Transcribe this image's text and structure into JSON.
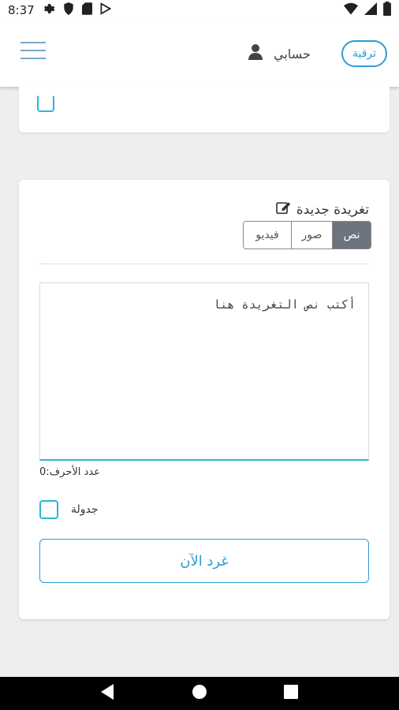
{
  "status_bar": {
    "time": "8:37",
    "icons_left": [
      "settings-icon",
      "shield-icon",
      "sd-card-icon",
      "play-store-icon"
    ],
    "icons_right": [
      "wifi-icon",
      "signal-icon",
      "battery-icon"
    ]
  },
  "header": {
    "menu_icon": "hamburger-menu-icon",
    "account_label": "حسابي",
    "account_icon": "user-icon",
    "upgrade_label": "ترقية",
    "accent_color": "#2f9bd6"
  },
  "compose": {
    "title": "تغريدة جديدة",
    "title_icon": "edit-icon",
    "tabs": [
      {
        "label": "فيديو",
        "active": false
      },
      {
        "label": "صور",
        "active": false
      },
      {
        "label": "نص",
        "active": true
      }
    ],
    "placeholder": "أكتب نص التغريدة هنا",
    "char_count_label": "عدد الأحرف:0",
    "schedule_label": "جدولة",
    "submit_label": "غرد الآن"
  },
  "nav_bar": {
    "buttons": [
      "back-icon",
      "home-icon",
      "recents-icon"
    ]
  }
}
